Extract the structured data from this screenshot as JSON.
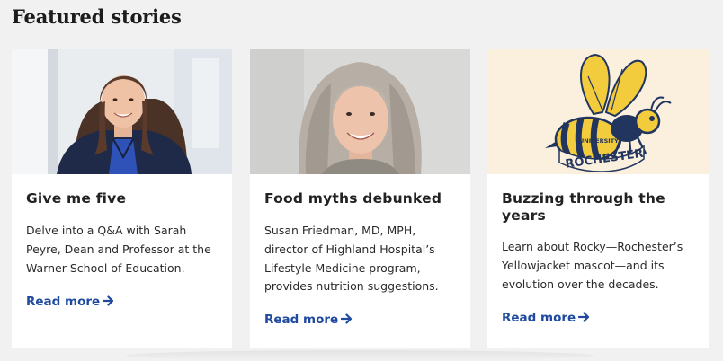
{
  "section": {
    "title": "Featured stories"
  },
  "cards": [
    {
      "title": "Give me five",
      "description": "Delve into a Q&A with Sarah Peyre, Dean and Professor at the Warner School of Education.",
      "link_label": "Read more",
      "image_icon": "portrait-photo-icon"
    },
    {
      "title": "Food myths debunked",
      "description": "Susan Friedman, MD, MPH, director of Highland Hospital’s Lifestyle Medicine program, provides nutrition suggestions.",
      "link_label": "Read more",
      "image_icon": "portrait-photo-icon"
    },
    {
      "title": "Buzzing through the years",
      "description": "Learn about Rocky—Rochester’s Yellowjacket mascot—and its evolution over the decades.",
      "link_label": "Read more",
      "image_icon": "yellowjacket-mascot-icon",
      "image_text": [
        "UNIVERSITY",
        "ROCHESTER"
      ]
    }
  ],
  "colors": {
    "background": "#f1f1f1",
    "card": "#ffffff",
    "link": "#1f4aa0",
    "mascot_background": "#fbf0dd",
    "mascot_yellow": "#f2cc3c",
    "mascot_navy": "#21355f"
  }
}
